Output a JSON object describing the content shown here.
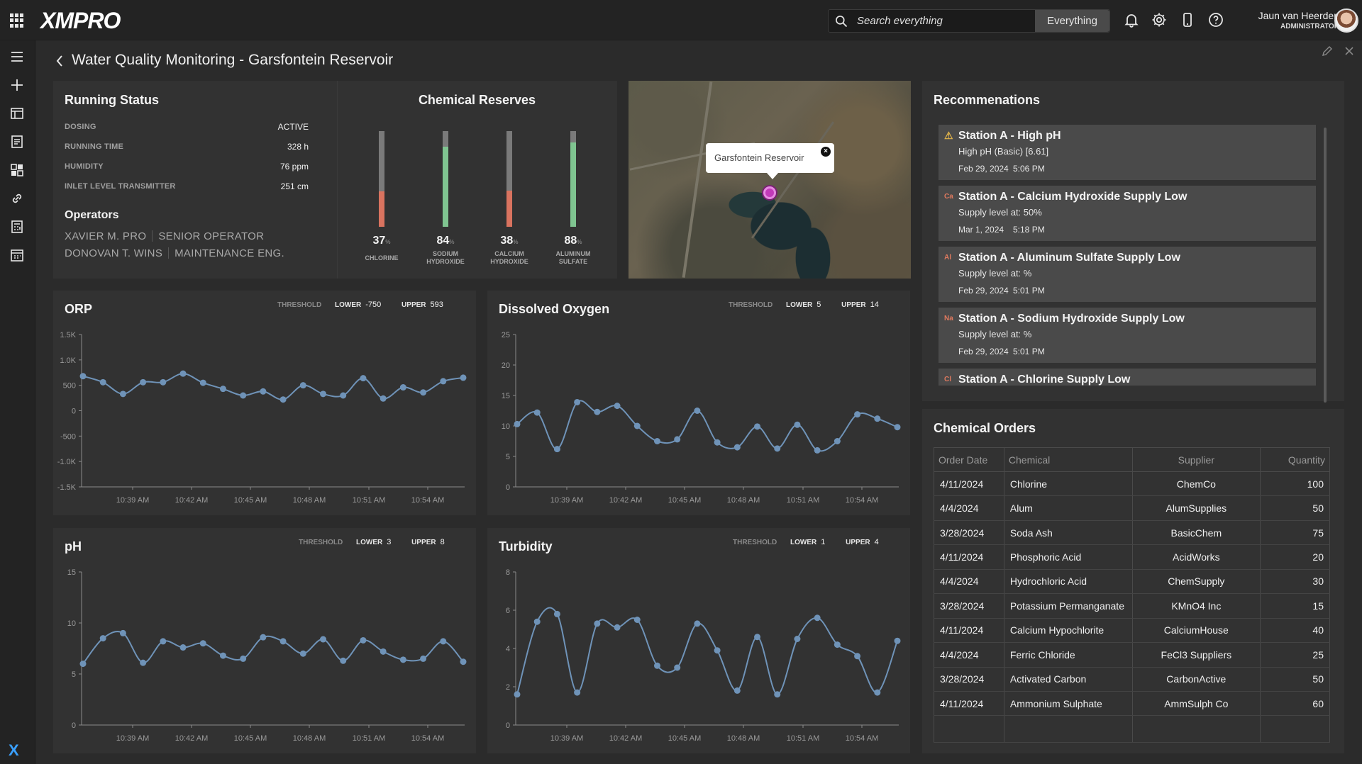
{
  "app": {
    "logo": "XMPRO",
    "search_placeholder": "Search everything",
    "search_scope": "Everything",
    "user_name": "Jaun van Heerden",
    "user_role": "ADMINISTRATOR"
  },
  "page": {
    "title": "Water Quality Monitoring - Garsfontein Reservoir"
  },
  "running_status": {
    "title": "Running Status",
    "rows": [
      {
        "key": "DOSING",
        "value": "ACTIVE"
      },
      {
        "key": "RUNNING TIME",
        "value": "328 h"
      },
      {
        "key": "HUMIDITY",
        "value": "76 ppm"
      },
      {
        "key": "INLET LEVEL TRANSMITTER",
        "value": "251 cm"
      }
    ],
    "operators_title": "Operators",
    "operators": [
      {
        "name": "XAVIER M. PRO",
        "role": "SENIOR OPERATOR"
      },
      {
        "name": "DONOVAN T. WINS",
        "role": "MAINTENANCE ENG."
      }
    ]
  },
  "chemical_reserves": {
    "title": "Chemical Reserves",
    "unit": "%",
    "items": [
      {
        "pct": 37,
        "label1": "CHLORINE",
        "label2": "",
        "color": "#d9735f"
      },
      {
        "pct": 84,
        "label1": "SODIUM",
        "label2": "HYDROXIDE",
        "color": "#7fc490"
      },
      {
        "pct": 38,
        "label1": "CALCIUM",
        "label2": "HYDROXIDE",
        "color": "#d9735f"
      },
      {
        "pct": 88,
        "label1": "ALUMINUM",
        "label2": "SULFATE",
        "color": "#7fc490"
      }
    ]
  },
  "map": {
    "popup_label": "Garsfontein Reservoir"
  },
  "recommendations": {
    "title": "Recommenations",
    "items": [
      {
        "badge": "⚠",
        "title": "Station A - High pH",
        "desc": "High pH (Basic) [6.61]",
        "date": "Feb 29, 2024",
        "time": "5:06 PM"
      },
      {
        "badge": "Ca",
        "title": "Station A - Calcium Hydroxide Supply Low",
        "desc": "Supply level at: 50%",
        "date": "Mar 1, 2024",
        "time": "5:18 PM"
      },
      {
        "badge": "Al",
        "title": "Station A - Aluminum Sulfate Supply Low",
        "desc": "Supply level at: %",
        "date": "Feb 29, 2024",
        "time": "5:01 PM"
      },
      {
        "badge": "Na",
        "title": "Station A - Sodium Hydroxide Supply Low",
        "desc": "Supply level at: %",
        "date": "Feb 29, 2024",
        "time": "5:01 PM"
      },
      {
        "badge": "Cl",
        "title": "Station A - Chlorine Supply Low",
        "desc": "",
        "date": "",
        "time": ""
      }
    ]
  },
  "orders": {
    "title": "Chemical Orders",
    "columns": [
      "Order Date",
      "Chemical",
      "Supplier",
      "Quantity"
    ],
    "rows": [
      [
        "4/11/2024",
        "Chlorine",
        "ChemCo",
        "100"
      ],
      [
        "4/4/2024",
        "Alum",
        "AlumSupplies",
        "50"
      ],
      [
        "3/28/2024",
        "Soda Ash",
        "BasicChem",
        "75"
      ],
      [
        "4/11/2024",
        "Phosphoric Acid",
        "AcidWorks",
        "20"
      ],
      [
        "4/4/2024",
        "Hydrochloric Acid",
        "ChemSupply",
        "30"
      ],
      [
        "3/28/2024",
        "Potassium Permanganate",
        "KMnO4 Inc",
        "15"
      ],
      [
        "4/11/2024",
        "Calcium Hypochlorite",
        "CalciumHouse",
        "40"
      ],
      [
        "4/4/2024",
        "Ferric Chloride",
        "FeCl3 Suppliers",
        "25"
      ],
      [
        "3/28/2024",
        "Activated Carbon",
        "CarbonActive",
        "50"
      ],
      [
        "4/11/2024",
        "Ammonium Sulphate",
        "AmmSulph Co",
        "60"
      ]
    ]
  },
  "threshold_labels": {
    "threshold": "THRESHOLD",
    "lower": "LOWER",
    "upper": "UPPER"
  },
  "chart_data": [
    {
      "type": "line",
      "title": "ORP",
      "threshold_lower": "-750",
      "threshold_upper": "593",
      "ylim": [
        -1500,
        1500
      ],
      "yticks": [
        -1500,
        -1000,
        -500,
        0,
        500,
        1000,
        1500
      ],
      "ytick_labels": [
        "-1.5K",
        "-1.0K",
        "-500",
        "0",
        "500",
        "1.0K",
        "1.5K"
      ],
      "xtick_labels": [
        "10:39 AM",
        "10:42 AM",
        "10:45 AM",
        "10:48 AM",
        "10:51 AM",
        "10:54 AM"
      ],
      "color": "#6f93b8",
      "values": [
        680,
        560,
        330,
        560,
        560,
        730,
        550,
        430,
        300,
        380,
        220,
        500,
        330,
        300,
        640,
        240,
        460,
        360,
        580,
        650
      ]
    },
    {
      "type": "line",
      "title": "Dissolved Oxygen",
      "threshold_lower": "5",
      "threshold_upper": "14",
      "ylim": [
        0,
        25
      ],
      "yticks": [
        0,
        5,
        10,
        15,
        20,
        25
      ],
      "ytick_labels": [
        "0",
        "5",
        "10",
        "15",
        "20",
        "25"
      ],
      "xtick_labels": [
        "10:39 AM",
        "10:42 AM",
        "10:45 AM",
        "10:48 AM",
        "10:51 AM",
        "10:54 AM"
      ],
      "color": "#6f93b8",
      "values": [
        10.3,
        12.2,
        6.2,
        13.9,
        12.3,
        13.3,
        10.0,
        7.5,
        7.8,
        12.5,
        7.3,
        6.5,
        9.9,
        6.3,
        10.2,
        6.0,
        7.5,
        11.9,
        11.2,
        9.8
      ]
    },
    {
      "type": "line",
      "title": "pH",
      "threshold_lower": "3",
      "threshold_upper": "8",
      "ylim": [
        0,
        15
      ],
      "yticks": [
        0,
        5,
        10,
        15
      ],
      "ytick_labels": [
        "0",
        "5",
        "10",
        "15"
      ],
      "xtick_labels": [
        "10:39 AM",
        "10:42 AM",
        "10:45 AM",
        "10:48 AM",
        "10:51 AM",
        "10:54 AM"
      ],
      "color": "#6f93b8",
      "values": [
        6.0,
        8.5,
        9.0,
        6.1,
        8.2,
        7.6,
        8.0,
        6.8,
        6.5,
        8.6,
        8.2,
        7.0,
        8.4,
        6.3,
        8.3,
        7.2,
        6.4,
        6.5,
        8.2,
        6.2
      ]
    },
    {
      "type": "line",
      "title": "Turbidity",
      "threshold_lower": "1",
      "threshold_upper": "4",
      "ylim": [
        0,
        8
      ],
      "yticks": [
        0,
        2,
        4,
        6,
        8
      ],
      "ytick_labels": [
        "0",
        "2",
        "4",
        "6",
        "8"
      ],
      "xtick_labels": [
        "10:39 AM",
        "10:42 AM",
        "10:45 AM",
        "10:48 AM",
        "10:51 AM",
        "10:54 AM"
      ],
      "color": "#6f93b8",
      "values": [
        1.6,
        5.4,
        5.8,
        1.7,
        5.3,
        5.1,
        5.5,
        3.1,
        3.0,
        5.3,
        3.9,
        1.8,
        4.6,
        1.6,
        4.5,
        5.6,
        4.2,
        3.6,
        1.7,
        4.4
      ]
    }
  ]
}
